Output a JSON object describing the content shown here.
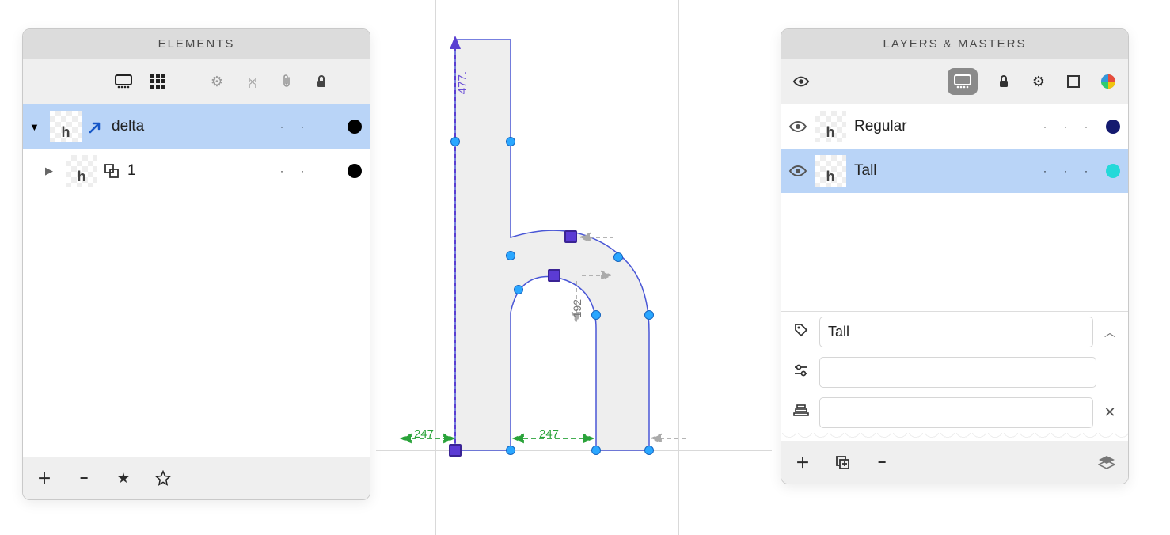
{
  "elements_panel": {
    "title": "ELEMENTS",
    "rows": [
      {
        "name": "delta",
        "thumb_letter": "h",
        "selected": true,
        "chip": "black",
        "disclosure": "▼",
        "icon": "arrow-link"
      },
      {
        "name": "1",
        "thumb_letter": "h",
        "selected": false,
        "chip": "black",
        "disclosure": "▶",
        "icon": "overlap"
      }
    ]
  },
  "layers_panel": {
    "title": "LAYERS & MASTERS",
    "rows": [
      {
        "name": "Regular",
        "thumb_letter": "h",
        "chip": "navy",
        "selected": false
      },
      {
        "name": "Tall",
        "thumb_letter": "h",
        "chip": "cyan",
        "selected": true
      }
    ],
    "prop_name_value": "Tall"
  },
  "canvas": {
    "measure_left": "247",
    "measure_right": "247",
    "vertical_left": "477.",
    "vertical_inner": "192"
  }
}
